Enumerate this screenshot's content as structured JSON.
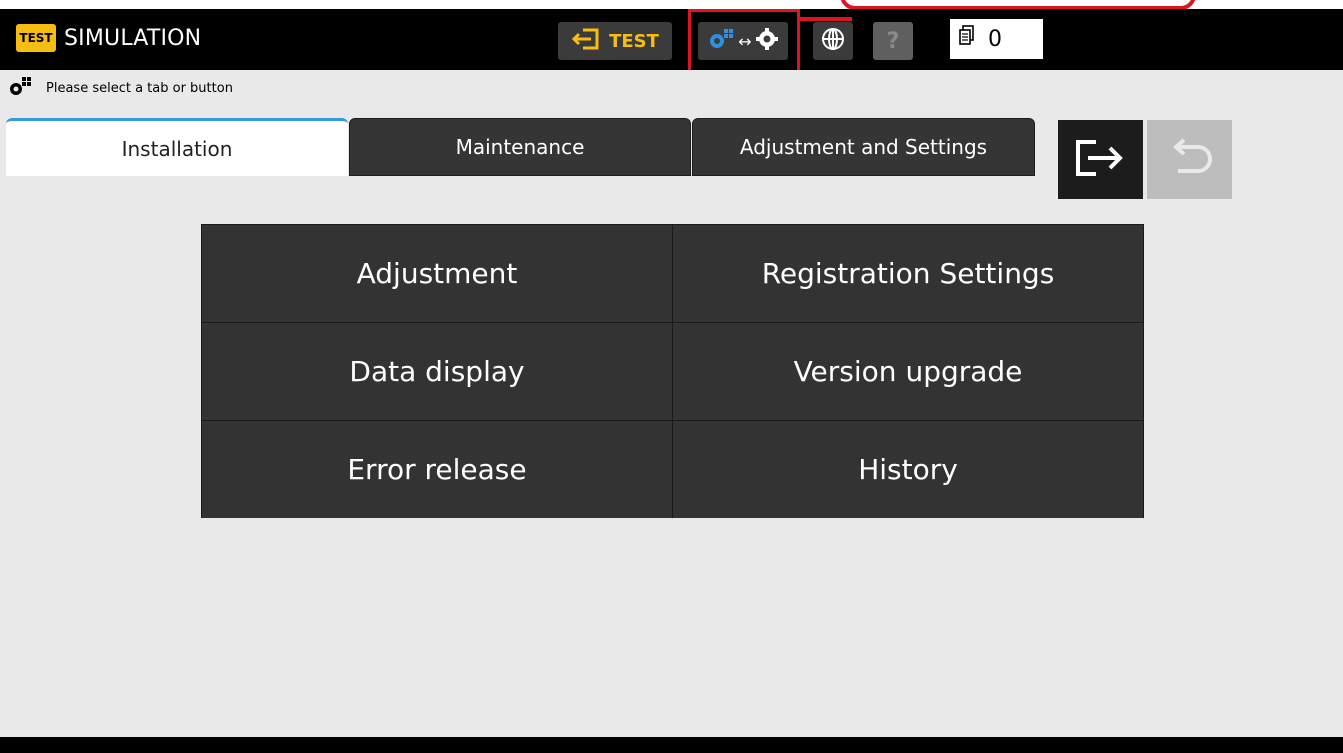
{
  "header": {
    "badge": "TEST",
    "title": "SIMULATION",
    "test_mode_label": "TEST",
    "counter_value": "0"
  },
  "status": {
    "message": "Please select a tab or button"
  },
  "tabs": [
    {
      "label": "Installation",
      "active": true
    },
    {
      "label": "Maintenance",
      "active": false
    },
    {
      "label": "Adjustment and Settings",
      "active": false
    }
  ],
  "menu": [
    {
      "label": "Adjustment"
    },
    {
      "label": "Registration Settings"
    },
    {
      "label": "Data display"
    },
    {
      "label": "Version upgrade"
    },
    {
      "label": "Error release"
    },
    {
      "label": "History"
    }
  ],
  "icons": {
    "settings": "gear-icon",
    "switch": "mode-switch-icon",
    "globe": "globe-icon",
    "help": "help-icon",
    "counter": "document-counter-icon",
    "exit": "exit-icon",
    "back": "back-icon",
    "test_enter": "enter-test-icon"
  },
  "colors": {
    "accent_yellow": "#f6bd12",
    "highlight_red": "#e0141e",
    "active_tab_accent": "#3a9ad9",
    "settings_blue": "#2f8fe0"
  }
}
